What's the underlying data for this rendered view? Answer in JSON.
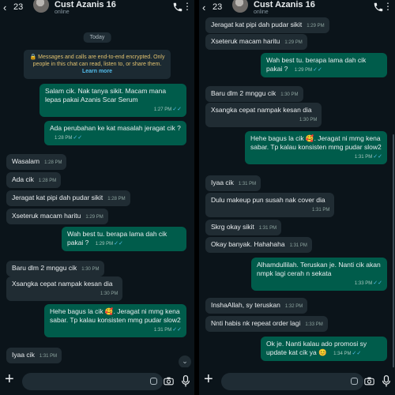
{
  "left": {
    "header": {
      "back_count": "23",
      "name": "Cust Azanis 16",
      "status": "online"
    },
    "day": "Today",
    "notice": {
      "text": "Messages and calls are end-to-end encrypted. Only people in this chat can read, listen to, or share them.",
      "link": "Learn more"
    },
    "messages": [
      {
        "dir": "out",
        "text": "Salam cik. Nak tanya sikit. Macam mana lepas pakai Azanis Scar Serum",
        "time": "1:27 PM"
      },
      {
        "dir": "out",
        "text": "Ada perubahan ke kat masalah jeragat cik ?",
        "time": "1:28 PM"
      },
      {
        "dir": "in",
        "text": "Wasalam",
        "time": "1:28 PM"
      },
      {
        "dir": "in",
        "text": "Ada cik",
        "time": "1:28 PM"
      },
      {
        "dir": "in",
        "text": "Jeragat kat pipi dah pudar sikit",
        "time": "1:28 PM"
      },
      {
        "dir": "in",
        "text": "Xseteruk macam haritu",
        "time": "1:29 PM"
      },
      {
        "dir": "out",
        "text": "Wah best tu. berapa lama dah cik pakai ?",
        "time": "1:29 PM"
      },
      {
        "dir": "in",
        "text": "Baru dlm 2 mnggu cik",
        "time": "1:30 PM"
      },
      {
        "dir": "in",
        "text": "Xsangka cepat nampak kesan dia",
        "time": "1:30 PM"
      },
      {
        "dir": "out",
        "text": "Hehe bagus la cik 🥰. Jeragat ni mmg kena sabar. Tp kalau konsisten mmg pudar slow2",
        "time": "1:31 PM"
      },
      {
        "dir": "in",
        "text": "Iyaa cik",
        "time": "1:31 PM"
      }
    ]
  },
  "right": {
    "header": {
      "back_count": "23",
      "name": "Cust Azanis 16",
      "status": "online"
    },
    "messages": [
      {
        "dir": "in",
        "text": "Jeragat kat pipi dah pudar sikit",
        "time": "1:29 PM"
      },
      {
        "dir": "in",
        "text": "Xseteruk macam haritu",
        "time": "1:29 PM"
      },
      {
        "dir": "out",
        "text": "Wah best tu. berapa lama dah cik pakai ?",
        "time": "1:29 PM"
      },
      {
        "dir": "in",
        "text": "Baru dlm 2 mnggu cik",
        "time": "1:30 PM"
      },
      {
        "dir": "in",
        "text": "Xsangka cepat nampak kesan dia",
        "time": "1:30 PM"
      },
      {
        "dir": "out",
        "text": "Hehe bagus la cik 🥰. Jeragat ni mmg kena sabar. Tp kalau konsisten mmg pudar slow2",
        "time": "1:31 PM"
      },
      {
        "dir": "in",
        "text": "Iyaa cik",
        "time": "1:31 PM"
      },
      {
        "dir": "in",
        "text": "Dulu makeup pun susah nak cover dia",
        "time": "1:31 PM"
      },
      {
        "dir": "in",
        "text": "Skrg okay sikit",
        "time": "1:31 PM"
      },
      {
        "dir": "in",
        "text": "Okay banyak. Hahahaha",
        "time": "1:31 PM"
      },
      {
        "dir": "out",
        "text": "Alhamdullilah. Teruskan je. Nanti cik akan nmpk lagi cerah n sekata",
        "time": "1:33 PM"
      },
      {
        "dir": "in",
        "text": "InshaAllah, sy teruskan",
        "time": "1:32 PM"
      },
      {
        "dir": "in",
        "text": "Nnti habis nk repeat order lagi",
        "time": "1:33 PM"
      },
      {
        "dir": "out",
        "text": "Ok je. Nanti kalau ado promosi sy update kat cik ya 😊",
        "time": "1:34 PM"
      }
    ]
  },
  "colors": {
    "background": "#0b141a",
    "incoming": "#202c33",
    "outgoing": "#005c4b",
    "read_ticks": "#53bdeb"
  }
}
